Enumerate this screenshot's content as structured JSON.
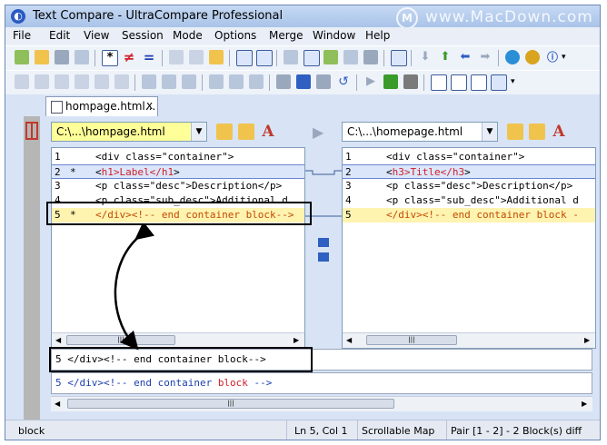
{
  "window": {
    "title": "Text Compare - UltraCompare Professional"
  },
  "watermark": {
    "logo": "M",
    "text": "www.MacDown.com"
  },
  "menu": [
    "File",
    "Edit",
    "View",
    "Session",
    "Mode",
    "Options",
    "Merge",
    "Window",
    "Help"
  ],
  "toolbar": {
    "wildcard_label": "*",
    "not_equal_label": "≠",
    "equal_label": "="
  },
  "tab": {
    "label": "hompage.html...",
    "close": "x"
  },
  "left": {
    "file": "C:\\...\\hompage.html",
    "lines": [
      {
        "num": "1",
        "marker": "",
        "pre": "<div class=\"container\">",
        "diff": "",
        "post": ""
      },
      {
        "num": "2",
        "marker": "*",
        "pre": "<",
        "diff": "h1>Label</h1",
        "post": ">"
      },
      {
        "num": "3",
        "marker": "",
        "pre": "<p class=\"desc\">Description</p>",
        "diff": "",
        "post": ""
      },
      {
        "num": "4",
        "marker": "",
        "pre": "<p class=\"sub_desc\">Additional d",
        "diff": "",
        "post": ""
      },
      {
        "num": "5",
        "marker": "*",
        "pre": "</div><!-- end container block-->",
        "diff": "",
        "post": ""
      }
    ]
  },
  "right": {
    "file": "C:\\...\\homepage.html",
    "lines": [
      {
        "num": "1",
        "pre": "<div class=\"container\">",
        "diff": "",
        "post": ""
      },
      {
        "num": "2",
        "pre": "<",
        "diff": "h3>Title</h3",
        "post": ">"
      },
      {
        "num": "3",
        "pre": "<p class=\"desc\">Description</p>",
        "diff": "",
        "post": ""
      },
      {
        "num": "4",
        "pre": "<p class=\"sub_desc\">Additional d",
        "diff": "",
        "post": ""
      },
      {
        "num": "5",
        "pre": "</div><!-- end container block -",
        "diff": "",
        "post": ""
      }
    ]
  },
  "line_view": {
    "top": "5 </div><!-- end container block-->",
    "bottom_pre": "5 </div><!-- end container ",
    "bottom_diff": "block",
    "bottom_post": " -->"
  },
  "status": {
    "mode": "block",
    "position": "Ln 5, Col 1",
    "map": "Scrollable Map",
    "pair": "Pair [1 - 2] - 2 Block(s) diff"
  },
  "colors": {
    "diff_text": "#d0202a",
    "diff_line_bg": "#dbe6fb",
    "current_line_bg": "#fff3b0",
    "active_file_bg": "#ffff99",
    "annotation": "#000000"
  }
}
